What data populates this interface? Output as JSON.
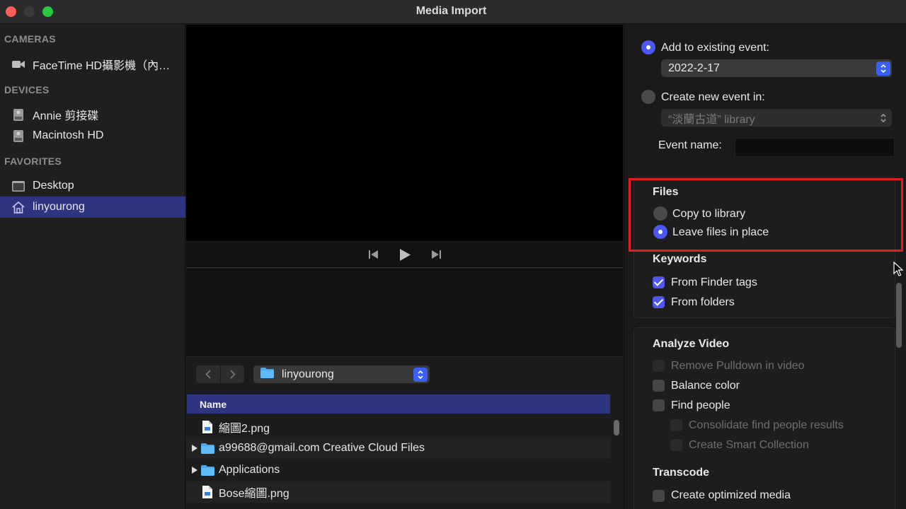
{
  "window": {
    "title": "Media Import"
  },
  "sidebar": {
    "sections": [
      {
        "header": "CAMERAS",
        "items": [
          {
            "label": "FaceTime HD攝影機（內…",
            "icon": "camera-icon"
          }
        ]
      },
      {
        "header": "DEVICES",
        "items": [
          {
            "label": "Annie 剪接碟",
            "icon": "drive-icon"
          },
          {
            "label": "Macintosh HD",
            "icon": "drive-icon"
          }
        ]
      },
      {
        "header": "FAVORITES",
        "items": [
          {
            "label": "Desktop",
            "icon": "desktop-icon"
          },
          {
            "label": "linyourong",
            "icon": "home-icon",
            "selected": true
          }
        ]
      }
    ]
  },
  "browser": {
    "current_folder": "linyourong",
    "column_header": "Name",
    "files": [
      {
        "name": "縮圖2.png",
        "type": "file"
      },
      {
        "name": "a99688@gmail.com Creative Cloud Files",
        "type": "folder"
      },
      {
        "name": "Applications",
        "type": "folder"
      },
      {
        "name": "Bose縮圖.png",
        "type": "file"
      }
    ]
  },
  "options": {
    "add_existing_label": "Add to existing event:",
    "existing_event_value": "2022-2-17",
    "create_new_label": "Create new event in:",
    "new_event_library": "“淡蘭古道” library",
    "event_name_label": "Event name:",
    "event_name_value": "",
    "files": {
      "title": "Files",
      "copy_label": "Copy to library",
      "leave_label": "Leave files in place",
      "selected": "leave"
    },
    "keywords": {
      "title": "Keywords",
      "items": [
        {
          "label": "From Finder tags",
          "checked": true
        },
        {
          "label": "From folders",
          "checked": true
        }
      ]
    },
    "analyze_video": {
      "title": "Analyze Video",
      "items": [
        {
          "label": "Remove Pulldown in video",
          "checked": false,
          "enabled": false
        },
        {
          "label": "Balance color",
          "checked": false,
          "enabled": true
        },
        {
          "label": "Find people",
          "checked": false,
          "enabled": true
        },
        {
          "label": "Consolidate find people results",
          "checked": false,
          "enabled": false
        },
        {
          "label": "Create Smart Collection",
          "checked": false,
          "enabled": false
        }
      ]
    },
    "transcode": {
      "title": "Transcode",
      "items": [
        {
          "label": "Create optimized media",
          "checked": false
        }
      ]
    }
  },
  "colors": {
    "accent": "#4d57f2",
    "selection": "#2e3580",
    "highlight_box": "#e11d1d"
  }
}
